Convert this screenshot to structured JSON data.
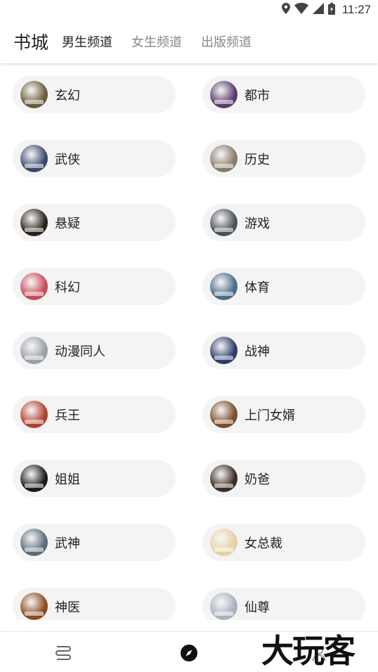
{
  "status_bar": {
    "time": "11:27"
  },
  "header": {
    "title": "书城",
    "tabs": [
      "男生频道",
      "女生频道",
      "出版频道"
    ]
  },
  "categories": [
    {
      "label": "玄幻",
      "color": "#6b5a3a"
    },
    {
      "label": "都市",
      "color": "#5a3a6b"
    },
    {
      "label": "武侠",
      "color": "#3a4a6b"
    },
    {
      "label": "历史",
      "color": "#8a7a6a"
    },
    {
      "label": "悬疑",
      "color": "#2a2018"
    },
    {
      "label": "游戏",
      "color": "#4a5058"
    },
    {
      "label": "科幻",
      "color": "#c84a5a"
    },
    {
      "label": "体育",
      "color": "#4a6a8a"
    },
    {
      "label": "动漫同人",
      "color": "#9aa0a8"
    },
    {
      "label": "战神",
      "color": "#2a3a6a"
    },
    {
      "label": "兵王",
      "color": "#b04030"
    },
    {
      "label": "上门女婿",
      "color": "#7a4a2a"
    },
    {
      "label": "姐姐",
      "color": "#1a1a1a"
    },
    {
      "label": "奶爸",
      "color": "#3a2a20"
    },
    {
      "label": "武神",
      "color": "#5a6a7a"
    },
    {
      "label": "女总裁",
      "color": "#e8d0a0"
    },
    {
      "label": "神医",
      "color": "#8a4a1a"
    },
    {
      "label": "仙尊",
      "color": "#a8b0c0"
    }
  ],
  "watermark": "大玩客"
}
